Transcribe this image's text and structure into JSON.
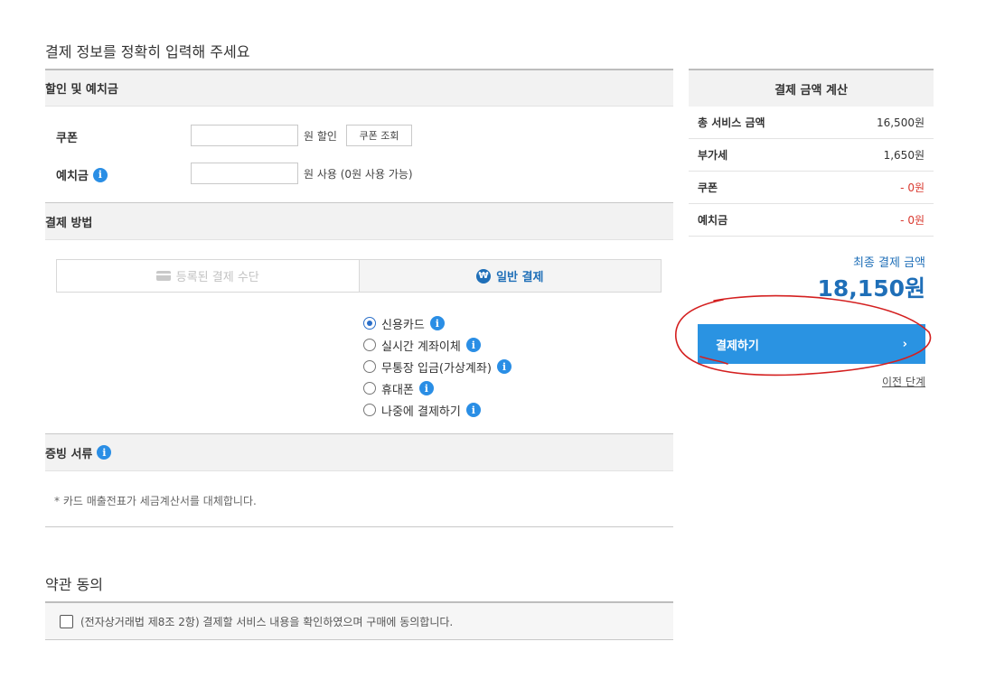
{
  "page": {
    "title": "결제 정보를 정확히 입력해 주세요"
  },
  "discount": {
    "header": "할인 및 예치금",
    "coupon_label": "쿠폰",
    "coupon_unit": "원 할인",
    "coupon_button": "쿠폰 조회",
    "deposit_label": "예치금",
    "deposit_unit": "원 사용  (0원 사용 가능)"
  },
  "payment": {
    "header": "결제 방법",
    "tab_registered": "등록된 결제 수단",
    "tab_general": "일반 결제",
    "methods": [
      "신용카드",
      "실시간 계좌이체",
      "무통장 입금(가상계좌)",
      "휴대폰",
      "나중에 결제하기"
    ],
    "selected_index": 0
  },
  "receipt": {
    "header": "증빙 서류",
    "note": "* 카드 매출전표가 세금계산서를 대체합니다."
  },
  "terms": {
    "title": "약관 동의",
    "agree_text": "(전자상거래법 제8조 2항) 결제할 서비스 내용을 확인하였으며 구매에 동의합니다."
  },
  "summary": {
    "header": "결제 금액 계산",
    "rows": [
      {
        "label": "총 서비스 금액",
        "value": "16,500원"
      },
      {
        "label": "부가세",
        "value": "1,650원"
      },
      {
        "label": "쿠폰",
        "value": "- 0원"
      },
      {
        "label": "예치금",
        "value": "- 0원"
      }
    ],
    "final_label": "최종 결제 금액",
    "final_amount": "18,150원",
    "pay_button": "결제하기",
    "pay_arrow": "›",
    "prev_link": "이전 단계"
  },
  "colors": {
    "accent": "#2a93e2",
    "brand_text": "#1f6fb8",
    "negative": "#d9382e",
    "annotation": "#d42020"
  }
}
